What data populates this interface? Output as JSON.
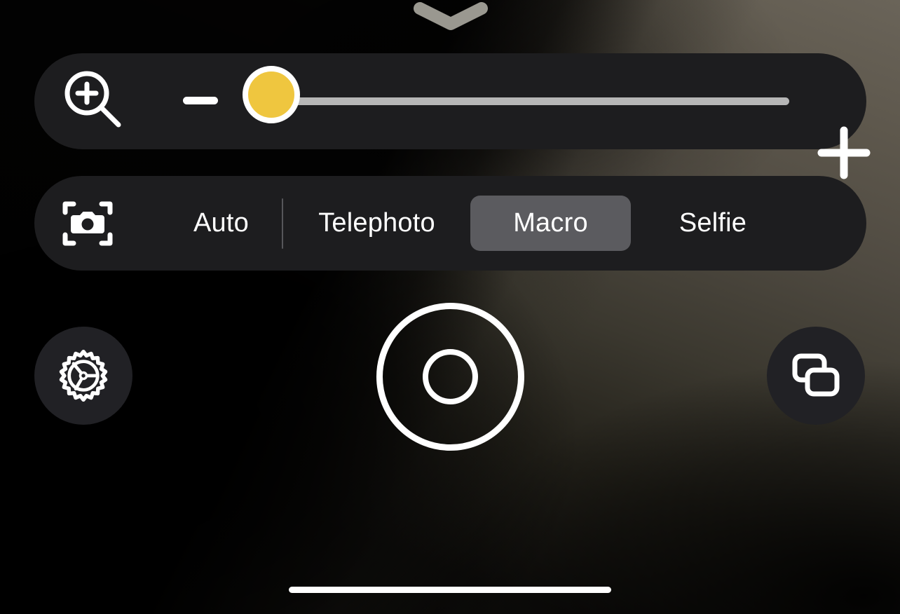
{
  "app": {
    "name": "Camera",
    "screen": "camera-viewfinder-controls"
  },
  "colors": {
    "bar_background": "#1D1D1F",
    "selected_pill": "#5B5B5F",
    "slider_thumb": "#EFC63F",
    "slider_track": "#B6B6B6",
    "icon_white": "#FFFFFF",
    "round_button": "#212125",
    "drag_handle": "#9A9890",
    "divider": "#56565A",
    "home_indicator": "#FFFFFF"
  },
  "drag_handle": {
    "icon": "chevron-down-icon",
    "label": "Collapse controls"
  },
  "zoom_control": {
    "icon": "magnifier-plus-icon",
    "decrease": {
      "icon": "minus-icon",
      "label": "Zoom out"
    },
    "increase": {
      "icon": "plus-icon",
      "label": "Zoom in"
    },
    "slider": {
      "name": "zoom-slider",
      "value": 0,
      "min": 0,
      "max": 100,
      "fill_percent": 0
    }
  },
  "mode_bar": {
    "icon": "camera-frame-icon",
    "modes": [
      {
        "label": "Auto",
        "selected": false
      },
      {
        "label": "Telephoto",
        "selected": false
      },
      {
        "label": "Macro",
        "selected": true
      },
      {
        "label": "Selfie",
        "selected": false
      }
    ],
    "selected_mode": "Macro"
  },
  "actions": {
    "settings": {
      "icon": "gear-icon",
      "label": "Settings"
    },
    "shutter": {
      "icon": "shutter-icon",
      "label": "Capture photo"
    },
    "gallery": {
      "icon": "layers-icon",
      "label": "Gallery"
    }
  },
  "system": {
    "home_indicator": "home-indicator"
  }
}
